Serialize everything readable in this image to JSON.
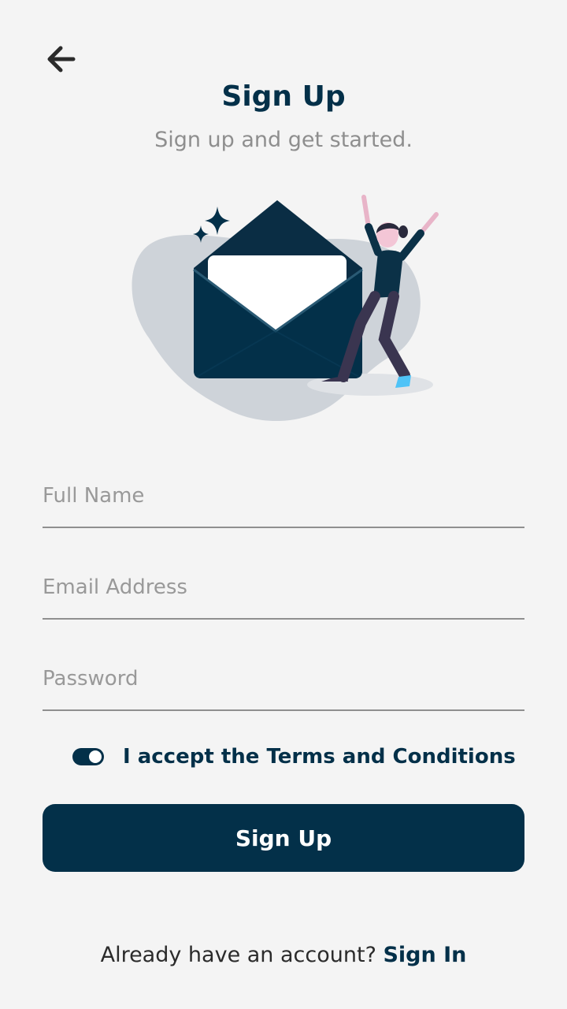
{
  "header": {
    "back_icon": "arrow-left-icon",
    "title": "Sign Up",
    "subtitle": "Sign up and get started."
  },
  "illustration": {
    "name": "envelope-celebration-illustration"
  },
  "form": {
    "full_name": {
      "placeholder": "Full Name",
      "value": ""
    },
    "email": {
      "placeholder": "Email Address",
      "value": ""
    },
    "password": {
      "placeholder": "Password",
      "value": ""
    },
    "terms": {
      "label": "I accept the Terms and Conditions",
      "checked": true
    }
  },
  "actions": {
    "signup_label": "Sign Up"
  },
  "footer": {
    "prompt": "Already have an account? ",
    "signin_label": "Sign In"
  },
  "colors": {
    "primary": "#033049",
    "background": "#f4f4f4",
    "muted_text": "#8e8e8e",
    "underline": "#8f8f8f"
  }
}
